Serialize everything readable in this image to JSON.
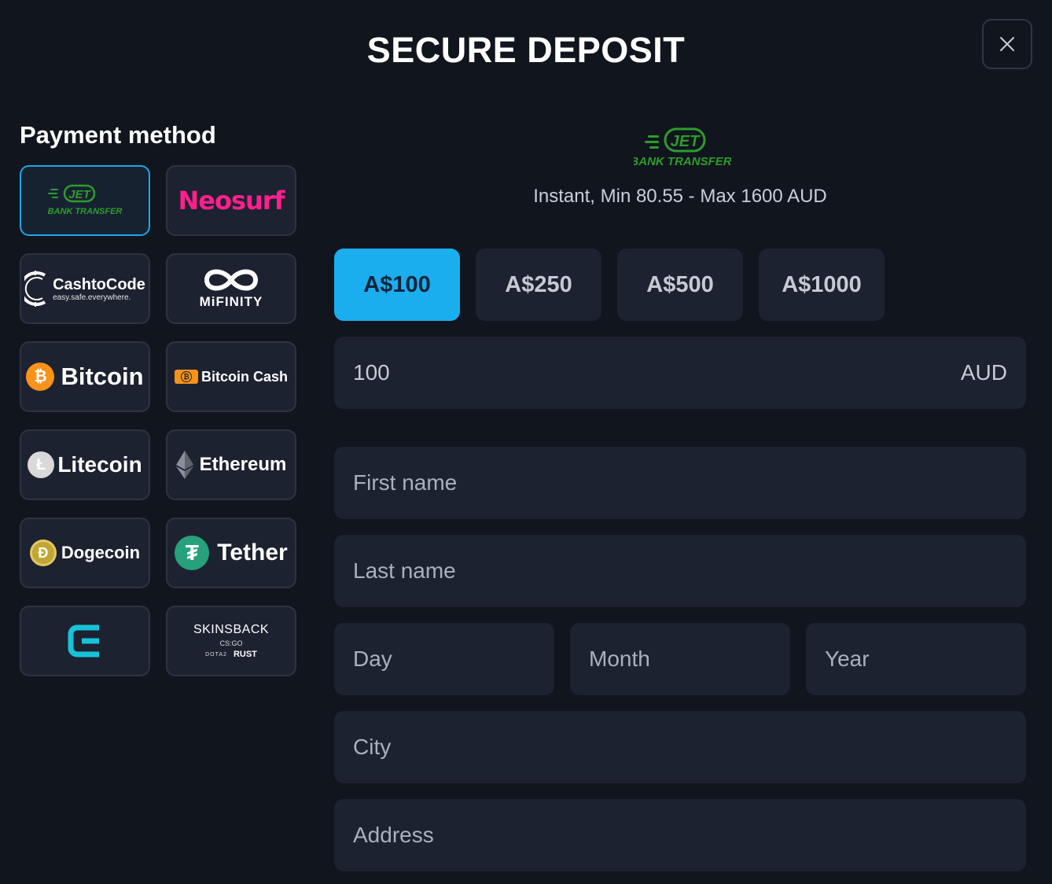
{
  "header": {
    "title": "SECURE DEPOSIT",
    "close_icon": "close-icon"
  },
  "payment": {
    "title": "Payment method",
    "methods": [
      {
        "id": "jet-bank-transfer",
        "logo_top": "JET",
        "logo_bottom": "BANK TRANSFER",
        "selected": true
      },
      {
        "id": "neosurf",
        "label": "Neosurf"
      },
      {
        "id": "cashtocode",
        "label_a": "Cashto",
        "label_b": "Code",
        "tagline": "easy.safe.everywhere."
      },
      {
        "id": "mifinity",
        "label": "MiFINITY"
      },
      {
        "id": "bitcoin",
        "label": "Bitcoin",
        "glyph": "₿"
      },
      {
        "id": "bitcoin-cash",
        "label": "Bitcoin Cash",
        "glyph": "₿"
      },
      {
        "id": "litecoin",
        "label": "Litecoin",
        "glyph": "Ł"
      },
      {
        "id": "ethereum",
        "label": "Ethereum"
      },
      {
        "id": "dogecoin",
        "label": "Dogecoin",
        "glyph": "Ð"
      },
      {
        "id": "tether",
        "label": "Tether",
        "glyph": "₮"
      },
      {
        "id": "e-wallet",
        "glyph": "E"
      },
      {
        "id": "skinsback",
        "label": "SKINSBACK",
        "sub1": "CS:GO",
        "sub2a": "DOTA2",
        "sub2b": "RUST"
      }
    ]
  },
  "selected_method": {
    "logo_top": "JET",
    "logo_bottom": "BANK TRANSFER",
    "info": "Instant, Min 80.55 - Max 1600 AUD"
  },
  "amounts": {
    "options": [
      "A$100",
      "A$250",
      "A$500",
      "A$1000"
    ],
    "active_index": 0
  },
  "amount_input": {
    "value": "100",
    "currency": "AUD"
  },
  "form": {
    "first_name": "First name",
    "last_name": "Last name",
    "day": "Day",
    "month": "Month",
    "year": "Year",
    "city": "City",
    "address": "Address"
  },
  "colors": {
    "background": "#11151e",
    "tile": "#1c2230",
    "accent": "#1aaeef",
    "neosurf": "#ff1f8e",
    "jet_green": "#3fbf3a",
    "bitcoin": "#f7931a",
    "tether": "#26a17b",
    "dogecoin": "#c2a633",
    "e_wallet": "#17c3d8"
  }
}
